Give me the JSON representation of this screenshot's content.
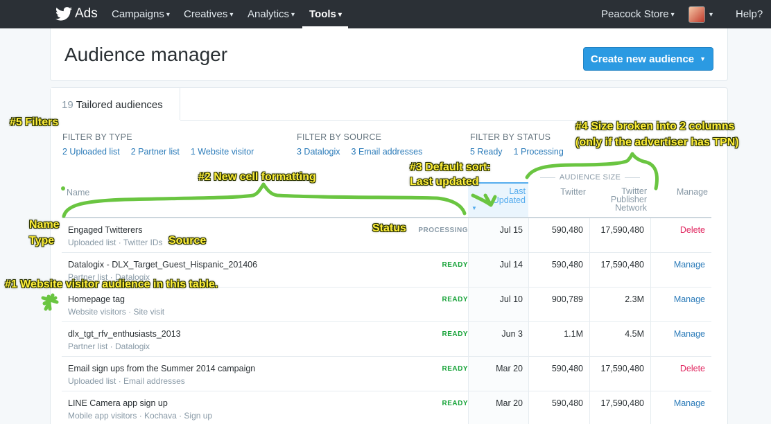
{
  "nav": {
    "brand": "Ads",
    "items": [
      {
        "label": "Campaigns"
      },
      {
        "label": "Creatives"
      },
      {
        "label": "Analytics"
      },
      {
        "label": "Tools"
      }
    ],
    "account": "Peacock Store",
    "help": "Help?"
  },
  "header": {
    "title": "Audience manager",
    "create_button": "Create new audience"
  },
  "tab": {
    "count": "19",
    "label": "Tailored audiences"
  },
  "filters": {
    "type": {
      "title": "FILTER BY TYPE",
      "links": [
        "2 Uploaded list",
        "2 Partner list",
        "1 Website visitor"
      ]
    },
    "source": {
      "title": "FILTER BY SOURCE",
      "links": [
        "3 Datalogix",
        "3 Email addresses"
      ]
    },
    "status": {
      "title": "FILTER BY STATUS",
      "links": [
        "5 Ready",
        "1 Processing"
      ]
    }
  },
  "table": {
    "headers": {
      "name": "Name",
      "last_updated_1": "Last",
      "last_updated_2": "Updated",
      "audience_size": "AUDIENCE SIZE",
      "twitter": "Twitter",
      "tpn_1": "Twitter",
      "tpn_2": "Publisher",
      "tpn_3": "Network",
      "manage": "Manage"
    },
    "rows": [
      {
        "name": "Engaged Twitterers",
        "sub": "Uploaded list · Twitter IDs",
        "status": "PROCESSING",
        "date": "Jul 15",
        "twitter": "590,480",
        "tpn": "17,590,480",
        "action": "Delete"
      },
      {
        "name": "Datalogix - DLX_Target_Guest_Hispanic_201406",
        "sub": "Partner list · Datalogix",
        "status": "READY",
        "date": "Jul 14",
        "twitter": "590,480",
        "tpn": "17,590,480",
        "action": "Manage"
      },
      {
        "name": "Homepage tag",
        "sub": "Website visitors · Site visit",
        "status": "READY",
        "date": "Jul 10",
        "twitter": "900,789",
        "tpn": "2.3M",
        "action": "Manage"
      },
      {
        "name": "dlx_tgt_rfv_enthusiasts_2013",
        "sub": "Partner list · Datalogix",
        "status": "READY",
        "date": "Jun 3",
        "twitter": "1.1M",
        "tpn": "4.5M",
        "action": "Manage"
      },
      {
        "name": "Email sign ups from the Summer 2014 campaign",
        "sub": "Uploaded list · Email addresses",
        "status": "READY",
        "date": "Mar 20",
        "twitter": "590,480",
        "tpn": "17,590,480",
        "action": "Delete"
      },
      {
        "name": "LINE Camera app sign up",
        "sub": "Mobile app visitors ·  Kochava · Sign up",
        "status": "READY",
        "date": "Mar 20",
        "twitter": "590,480",
        "tpn": "17,590,480",
        "action": "Manage"
      }
    ]
  },
  "annotations": {
    "filters": "#5 Filters",
    "size_1": "#4 Size broken into 2 columns",
    "size_2": "(only if the advertiser has TPN)",
    "cell_formatting": "#2 New cell formatting",
    "sort_1": "#3 Default sort:",
    "sort_2": "Last updated",
    "name": "Name",
    "type": "Type",
    "source": "Source",
    "status": "Status",
    "website": "#1  Website visitor audience in this table."
  },
  "colors": {
    "nav_bg": "#2b3036",
    "link": "#2b7bb9",
    "primary_button": "#2b9ae2",
    "ready": "#17a339",
    "delete": "#e0245e",
    "annotation_text": "#ffef3a",
    "annotation_stroke": "#6ac541"
  },
  "icons": {
    "brand": "twitter-bird-icon",
    "dropdown": "chevron-down-icon",
    "sort": "sort-desc-icon"
  }
}
